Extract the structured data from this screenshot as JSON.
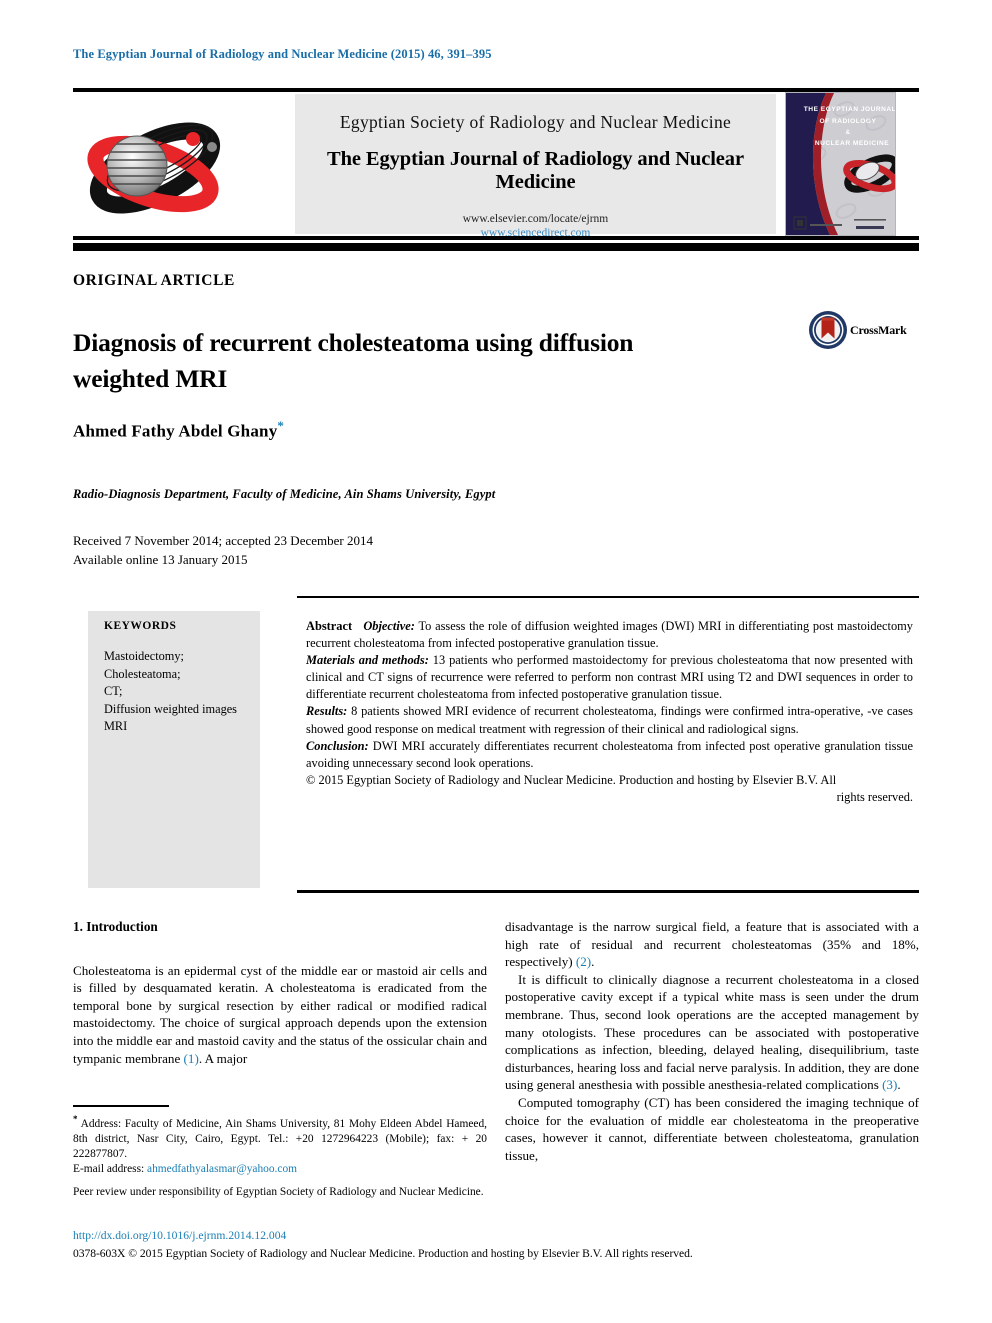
{
  "running_head": "The Egyptian Journal of Radiology and Nuclear Medicine (2015) 46, 391–395",
  "masthead": {
    "society": "Egyptian Society of Radiology and Nuclear Medicine",
    "journal": "The Egyptian Journal of Radiology and Nuclear Medicine",
    "url_publisher": "www.elsevier.com/locate/ejrnm",
    "url_platform": "www.sciencedirect.com",
    "logo_icon": "journal-logo-icon",
    "cover": {
      "line1": "THE EGYPTIAN JOURNAL",
      "line2": "OF RADIOLOGY",
      "line3": "&",
      "line4": "NUCLEAR MEDICINE"
    }
  },
  "article": {
    "kind": "ORIGINAL ARTICLE",
    "title": "Diagnosis of recurrent cholesteatoma using diffusion weighted MRI",
    "crossmark_label": "CrossMark",
    "author": "Ahmed Fathy Abdel Ghany",
    "author_marker": "*",
    "affiliation": "Radio-Diagnosis Department, Faculty of Medicine, Ain Shams University, Egypt",
    "received": "Received 7 November 2014; accepted 23 December 2014",
    "available": "Available online 13 January 2015"
  },
  "keywords": {
    "heading": "KEYWORDS",
    "items": [
      "Mastoidectomy;",
      "Cholesteatoma;",
      "CT;",
      "Diffusion weighted images",
      "MRI"
    ]
  },
  "abstract": {
    "label": "Abstract",
    "objective_label": "Objective:",
    "objective_text": "To assess the role of diffusion weighted images (DWI) MRI in differentiating post mastoidectomy recurrent cholesteatoma from infected postoperative granulation tissue.",
    "materials_label": "Materials and methods:",
    "materials_text": "13 patients who performed mastoidectomy for previous cholesteatoma that now presented with clinical and CT signs of recurrence were referred to perform non contrast MRI using T2 and DWI sequences in order to differentiate recurrent cholesteatoma from infected postoperative granulation tissue.",
    "results_label": "Results:",
    "results_text": "8 patients showed MRI evidence of recurrent cholesteatoma, findings were confirmed intra-operative, -ve cases showed good response on medical treatment with regression of their clinical and radiological signs.",
    "conclusion_label": "Conclusion:",
    "conclusion_text": "DWI MRI accurately differentiates recurrent cholesteatoma from infected post operative granulation tissue avoiding unnecessary second look operations.",
    "copyright": "© 2015 Egyptian Society of Radiology and Nuclear Medicine. Production and hosting by Elsevier B.V. All",
    "copyright_last": "rights reserved."
  },
  "body": {
    "section_heading": "1. Introduction",
    "left_p1_a": "Cholesteatoma is an epidermal cyst of the middle ear or mastoid air cells and is filled by desquamated keratin. A cholesteatoma is eradicated from the temporal bone by surgical resection by either radical or modified radical mastoidectomy. The choice of surgical approach depends upon the extension into the middle ear and mastoid cavity and the status of the ossicular chain and tympanic membrane ",
    "left_cite1": "(1)",
    "left_p1_b": ". A major",
    "right_p1_a": "disadvantage is the narrow surgical field, a feature that is associated with a high rate of residual and recurrent cholesteatomas (35% and 18%, respectively) ",
    "right_cite2": "(2)",
    "right_p1_b": ".",
    "right_p2_a": "It is difficult to clinically diagnose a recurrent cholesteatoma in a closed postoperative cavity except if a typical white mass is seen under the drum membrane. Thus, second look operations are the accepted management by many otologists. These procedures can be associated with postoperative complications as infection, bleeding, delayed healing, disequilibrium, taste disturbances, hearing loss and facial nerve paralysis. In addition, they are done using general anesthesia with possible anesthesia-related complications ",
    "right_cite3": "(3)",
    "right_p2_b": ".",
    "right_p3": "Computed tomography (CT) has been considered the imaging technique of choice for the evaluation of middle ear cholesteatoma in the preoperative cases, however it cannot, differentiate between cholesteatoma, granulation tissue,"
  },
  "footnote": {
    "marker": "*",
    "address": " Address: Faculty of Medicine, Ain Shams University, 81 Mohy Eldeen Abdel Hameed, 8th district, Nasr City, Cairo, Egypt. Tel.: +20 1272964223 (Mobile); fax: + 20 222877807.",
    "email_label": "E-mail address: ",
    "email": "ahmedfathyalasmar@yahoo.com",
    "peer_review": "Peer review under responsibility of Egyptian Society of Radiology and Nuclear Medicine."
  },
  "footer": {
    "doi": "http://dx.doi.org/10.1016/j.ejrnm.2014.12.004",
    "issn_line": "0378-603X © 2015 Egyptian Society of Radiology and Nuclear Medicine. Production and hosting by Elsevier B.V. All rights reserved."
  },
  "colors": {
    "link_blue": "#1a7fb5",
    "head_blue": "#1a6ea8",
    "panel_gray": "#e8e8e8",
    "keyword_gray": "#e4e4e4",
    "cover_navy": "#211b4e",
    "logo_red": "#e8262a"
  }
}
